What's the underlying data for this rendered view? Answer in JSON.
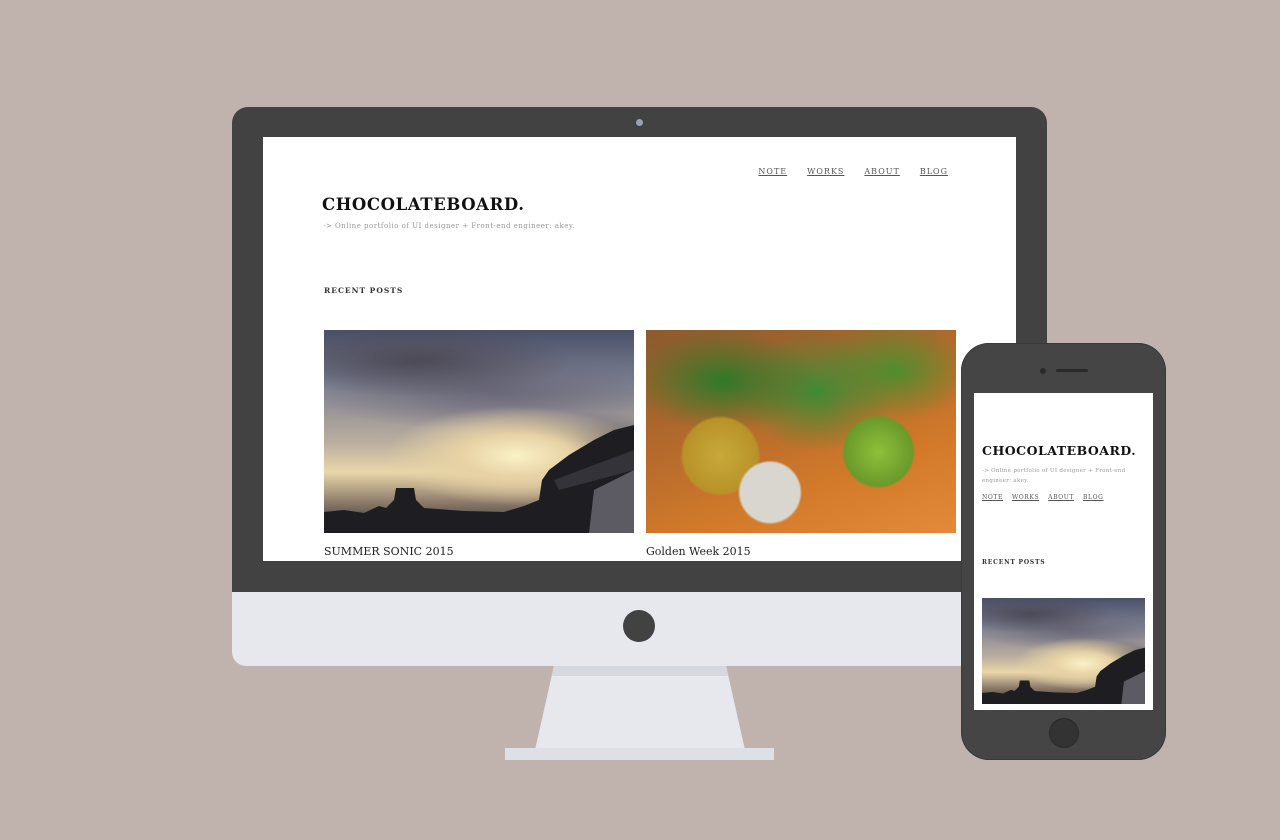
{
  "site": {
    "title": "CHOCOLATEBOARD.",
    "tagline": "-> Online portfolio of UI designer + Front-end engineer: akey."
  },
  "nav": {
    "items": [
      "NOTE",
      "WORKS",
      "ABOUT",
      "BLOG"
    ]
  },
  "recent_posts": {
    "heading": "RECENT POSTS",
    "posts": [
      {
        "title": "SUMMER SONIC 2015",
        "image": "sunset-sky-photo"
      },
      {
        "title": "Golden Week 2015",
        "image": "potted-plants-photo"
      }
    ]
  },
  "colors": {
    "background": "#c0b3ae",
    "device_dark": "#424242",
    "device_light": "#e6e8ee"
  }
}
